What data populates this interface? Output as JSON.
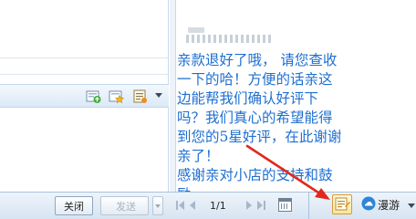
{
  "message": {
    "lines": [
      "亲款退好了哦，  请您查收",
      "一下的哈！方便的话亲这",
      "边能帮我们确认好评下",
      "吗？我们真心的希望能得",
      "到您的5星好评，在此谢谢",
      "亲了！",
      "感谢亲对小店的支持和鼓",
      "励。"
    ],
    "text_color": "#1e6fd0"
  },
  "toolbar": {
    "icons": [
      "green-upload-icon",
      "star-icon",
      "document-icon",
      "chevron-down-icon"
    ]
  },
  "bottom_bar": {
    "close_label": "关闭",
    "send_label": "发送",
    "page_indicator": "1/1",
    "roam_label": "漫游"
  },
  "annotation": {
    "arrow_color": "#e0281d"
  }
}
